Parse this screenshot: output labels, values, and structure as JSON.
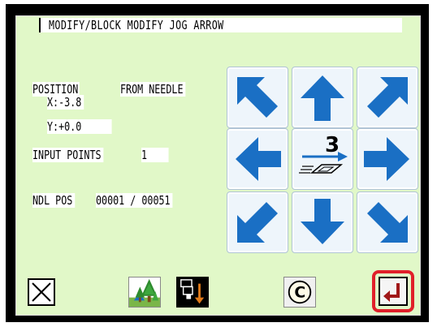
{
  "header": {
    "title": "MODIFY/BLOCK MODIFY  JOG ARROW"
  },
  "position": {
    "label": "POSITION",
    "reference": "FROM NEEDLE",
    "x": "X:-3.8",
    "y": "Y:+0.0"
  },
  "input_points": {
    "label": "INPUT POINTS",
    "value": "1"
  },
  "needle_pos": {
    "label": "NDL POS",
    "value": "00001 / 00051"
  },
  "jog": {
    "speed_value": "3",
    "buttons": [
      "up-left",
      "up",
      "up-right",
      "left",
      "speed",
      "right",
      "down-left",
      "down",
      "down-right"
    ]
  },
  "toolbar": {
    "cancel_icon": "close-icon",
    "tree_icon": "tree-icon",
    "needle_down_icon": "needle-down-icon",
    "copyright_icon": "c-icon",
    "enter_icon": "enter-icon"
  },
  "colors": {
    "panel": "#e1f8c8",
    "arrow": "#1a6fc4",
    "jog_bg": "#eef5fb",
    "highlight": "#e0202a"
  }
}
